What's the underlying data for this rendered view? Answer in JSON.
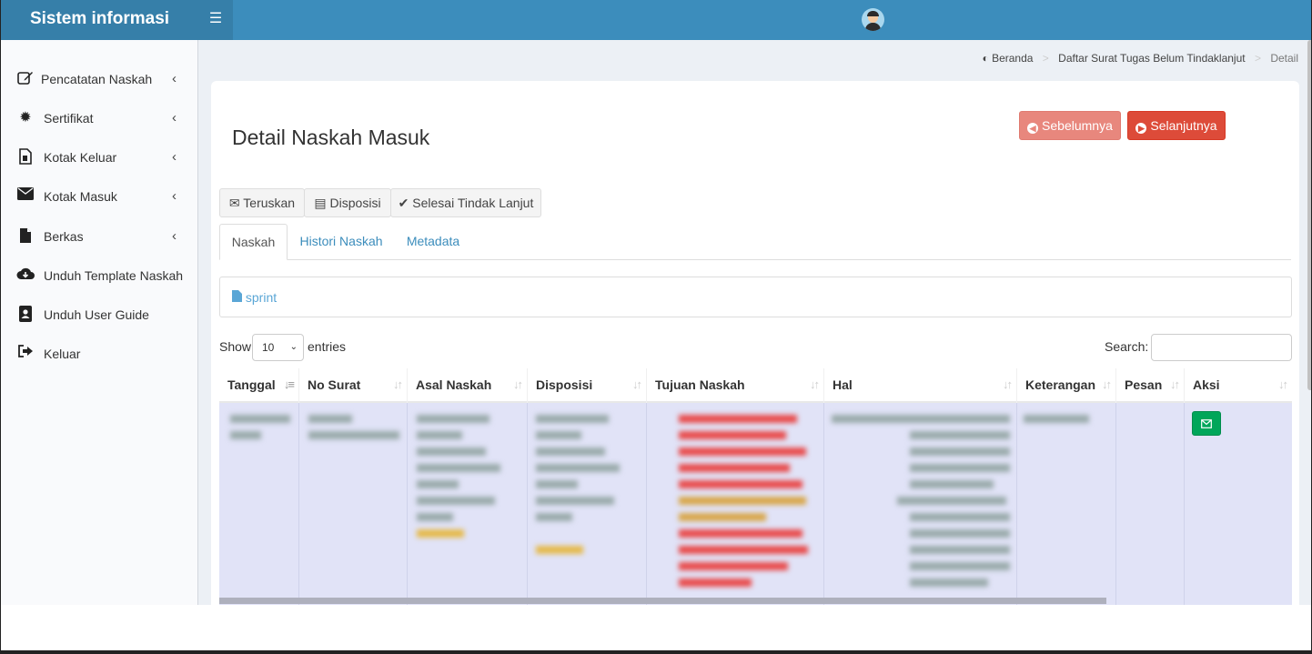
{
  "app": {
    "title": "Sistem informasi",
    "menu_toggle_icon": "hamburger-icon",
    "user_avatar": "user-avatar-icon"
  },
  "sidebar": {
    "items": [
      {
        "label": "Pencatatan Naskah",
        "icon": "edit-icon",
        "has_submenu": true
      },
      {
        "label": "Sertifikat",
        "icon": "certificate-icon",
        "has_submenu": true
      },
      {
        "label": "Kotak Keluar",
        "icon": "outbox-file-icon",
        "has_submenu": true
      },
      {
        "label": "Kotak Masuk",
        "icon": "envelope-icon",
        "has_submenu": true
      },
      {
        "label": "Berkas",
        "icon": "file-icon",
        "has_submenu": true
      },
      {
        "label": "Unduh Template Naskah",
        "icon": "cloud-download-icon",
        "has_submenu": false
      },
      {
        "label": "Unduh User Guide",
        "icon": "user-guide-icon",
        "has_submenu": false
      },
      {
        "label": "Keluar",
        "icon": "sign-out-icon",
        "has_submenu": false
      }
    ]
  },
  "breadcrumb": {
    "home": "Beranda",
    "list": "Daftar Surat Tugas Belum Tindaklanjut",
    "current": "Detail",
    "separator": ">"
  },
  "page": {
    "title": "Detail Naskah Masuk"
  },
  "nav_buttons": {
    "prev": "Sebelumnya",
    "next": "Selanjutnya"
  },
  "actions": {
    "forward": "Teruskan",
    "disposition": "Disposisi",
    "done": "Selesai Tindak Lanjut"
  },
  "tabs": [
    {
      "label": "Naskah",
      "active": true
    },
    {
      "label": "Histori Naskah",
      "active": false
    },
    {
      "label": "Metadata",
      "active": false
    }
  ],
  "attachment": {
    "name": "sprint"
  },
  "table_controls": {
    "show_label": "Show",
    "page_size": "10",
    "entries_label": "entries",
    "search_label": "Search:",
    "search_value": ""
  },
  "table": {
    "columns": [
      "Tanggal",
      "No Surat",
      "Asal Naskah",
      "Disposisi",
      "Tujuan Naskah",
      "Hal",
      "Keterangan",
      "Pesan",
      "Aksi"
    ],
    "sorted_column": "Tanggal",
    "row_action_icon": "envelope-icon",
    "colors": {
      "row_bg": "#e1e3f7",
      "action_green": "#00a65a"
    }
  },
  "colors": {
    "header": "#3c8dbc",
    "logo_bg": "#367fa9",
    "prev_button": "#e8877d",
    "next_button": "#dd4b39"
  }
}
